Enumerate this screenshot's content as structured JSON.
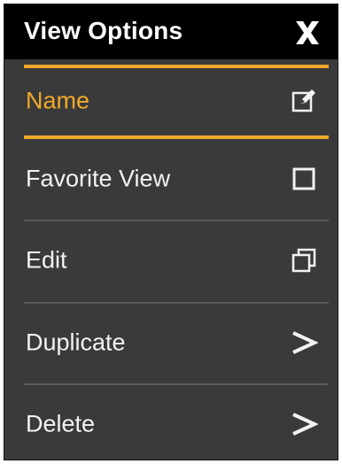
{
  "header": {
    "title": "View Options",
    "close_icon": "close-icon"
  },
  "items": [
    {
      "label": "Name",
      "icon": "edit-icon",
      "active": true
    },
    {
      "label": "Favorite View",
      "icon": "checkbox-icon",
      "checked": false
    },
    {
      "label": "Edit",
      "icon": "copy-icon"
    },
    {
      "label": "Duplicate",
      "icon": "chevron-right-icon"
    },
    {
      "label": "Delete",
      "icon": "chevron-right-icon"
    }
  ],
  "colors": {
    "accent": "#f0a92b",
    "background": "#3a3a3a",
    "header": "#000000",
    "text": "#f2f2f2"
  }
}
